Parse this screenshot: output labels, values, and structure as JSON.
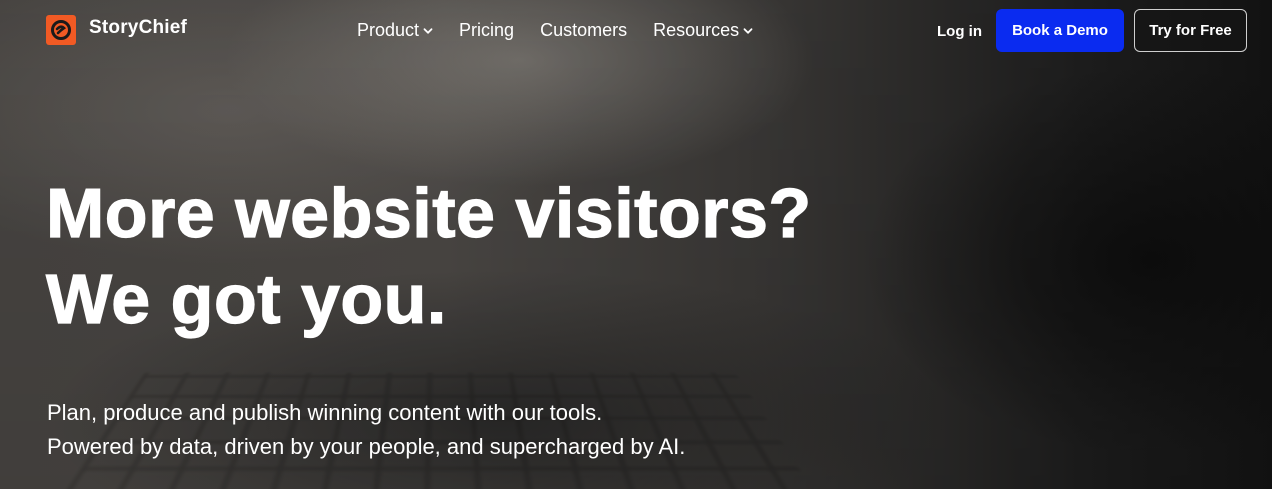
{
  "brand": {
    "name": "StoryChief",
    "logo_color": "#f15a24",
    "logo_icon": "storychief-logo-icon"
  },
  "nav": {
    "items": [
      {
        "label": "Product",
        "has_dropdown": true
      },
      {
        "label": "Pricing",
        "has_dropdown": false
      },
      {
        "label": "Customers",
        "has_dropdown": false
      },
      {
        "label": "Resources",
        "has_dropdown": true
      }
    ],
    "login_label": "Log in",
    "demo_label": "Book a Demo",
    "try_label": "Try for Free",
    "accent_color": "#0a2bf0"
  },
  "hero": {
    "headline_line1": "More website visitors?",
    "headline_line2": "We got you.",
    "sub_line1": "Plan, produce and publish winning content with our tools.",
    "sub_line2": "Powered by data, driven by your people, and supercharged by AI."
  }
}
